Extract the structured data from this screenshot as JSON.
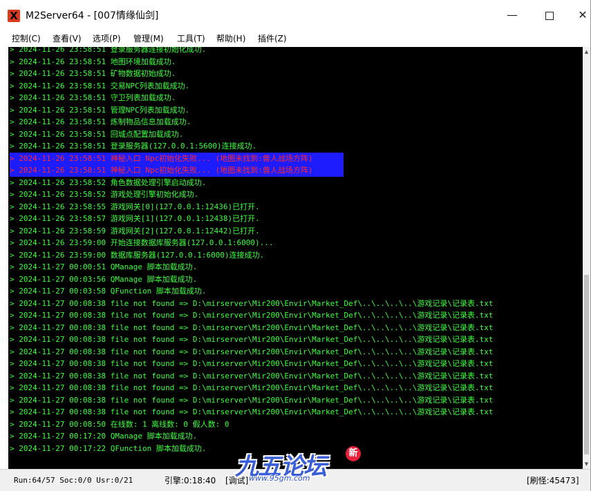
{
  "window": {
    "title": "M2Server64 - [007情缘仙剑]",
    "app_icon": "X",
    "controls": {
      "minimize": "—",
      "close": "✕"
    }
  },
  "menu": [
    "控制(C)",
    "查看(V)",
    "选项(P)",
    "管理(M)",
    "工具(T)",
    "帮助(H)",
    "插件(Z)"
  ],
  "log": [
    {
      "text": "> 2024-11-26 23:58:51 登录服务器连接初始化成功.",
      "level": "info"
    },
    {
      "text": "> 2024-11-26 23:58:51 地图环境加载成功.",
      "level": "info"
    },
    {
      "text": "> 2024-11-26 23:58:51 矿物数据初始成功.",
      "level": "info"
    },
    {
      "text": "> 2024-11-26 23:58:51 交易NPC列表加载成功.",
      "level": "info"
    },
    {
      "text": "> 2024-11-26 23:58:51 守卫列表加载成功.",
      "level": "info"
    },
    {
      "text": "> 2024-11-26 23:58:51 管理NPC列表加载成功.",
      "level": "info"
    },
    {
      "text": "> 2024-11-26 23:58:51 炼制物品信息加载成功.",
      "level": "info"
    },
    {
      "text": "> 2024-11-26 23:58:51 回城点配置加载成功.",
      "level": "info"
    },
    {
      "text": "> 2024-11-26 23:58:51 登录服务器(127.0.0.1:5600)连接成功.",
      "level": "info"
    },
    {
      "text": "> 2024-11-26 23:58:51 神秘入口 Npc初始化失败... (地图未找到:兽人战场方阵)",
      "level": "error"
    },
    {
      "text": "> 2024-11-26 23:58:51 神秘入口 Npc初始化失败... (地图未找到:兽人战场方阵)",
      "level": "error"
    },
    {
      "text": "> 2024-11-26 23:58:52 角色数据处理引擎启动成功.",
      "level": "info"
    },
    {
      "text": "> 2024-11-26 23:58:52 游戏处理引擎初始化成功.",
      "level": "info"
    },
    {
      "text": "> 2024-11-26 23:58:55 游戏网关[0](127.0.0.1:12436)已打开.",
      "level": "info"
    },
    {
      "text": "> 2024-11-26 23:58:57 游戏网关[1](127.0.0.1:12438)已打开.",
      "level": "info"
    },
    {
      "text": "> 2024-11-26 23:58:59 游戏网关[2](127.0.0.1:12442)已打开.",
      "level": "info"
    },
    {
      "text": "> 2024-11-26 23:59:00 开始连接数据库服务器(127.0.0.1:6000)...",
      "level": "info"
    },
    {
      "text": "> 2024-11-26 23:59:00 数据库服务器(127.0.0.1:6000)连接成功.",
      "level": "info"
    },
    {
      "text": "> 2024-11-27 00:00:51 QManage 脚本加载成功.",
      "level": "info"
    },
    {
      "text": "> 2024-11-27 00:03:56 QManage 脚本加载成功.",
      "level": "info"
    },
    {
      "text": "> 2024-11-27 00:03:58 QFunction 脚本加载成功.",
      "level": "info"
    },
    {
      "text": "> 2024-11-27 00:08:38 file not found => D:\\mirserver\\Mir200\\Envir\\Market_Def\\..\\..\\..\\..\\游戏记录\\记录表.txt",
      "level": "info"
    },
    {
      "text": "> 2024-11-27 00:08:38 file not found => D:\\mirserver\\Mir200\\Envir\\Market_Def\\..\\..\\..\\..\\游戏记录\\记录表.txt",
      "level": "info"
    },
    {
      "text": "> 2024-11-27 00:08:38 file not found => D:\\mirserver\\Mir200\\Envir\\Market_Def\\..\\..\\..\\..\\游戏记录\\记录表.txt",
      "level": "info"
    },
    {
      "text": "> 2024-11-27 00:08:38 file not found => D:\\mirserver\\Mir200\\Envir\\Market_Def\\..\\..\\..\\..\\游戏记录\\记录表.txt",
      "level": "info"
    },
    {
      "text": "> 2024-11-27 00:08:38 file not found => D:\\mirserver\\Mir200\\Envir\\Market_Def\\..\\..\\..\\..\\游戏记录\\记录表.txt",
      "level": "info"
    },
    {
      "text": "> 2024-11-27 00:08:38 file not found => D:\\mirserver\\Mir200\\Envir\\Market_Def\\..\\..\\..\\..\\游戏记录\\记录表.txt",
      "level": "info"
    },
    {
      "text": "> 2024-11-27 00:08:38 file not found => D:\\mirserver\\Mir200\\Envir\\Market_Def\\..\\..\\..\\..\\游戏记录\\记录表.txt",
      "level": "info"
    },
    {
      "text": "> 2024-11-27 00:08:38 file not found => D:\\mirserver\\Mir200\\Envir\\Market_Def\\..\\..\\..\\..\\游戏记录\\记录表.txt",
      "level": "info"
    },
    {
      "text": "> 2024-11-27 00:08:38 file not found => D:\\mirserver\\Mir200\\Envir\\Market_Def\\..\\..\\..\\..\\游戏记录\\记录表.txt",
      "level": "info"
    },
    {
      "text": "> 2024-11-27 00:08:38 file not found => D:\\mirserver\\Mir200\\Envir\\Market_Def\\..\\..\\..\\..\\游戏记录\\记录表.txt",
      "level": "info"
    },
    {
      "text": "> 2024-11-27 00:08:50 在线数: 1 离线数: 0 假人数: 0",
      "level": "info"
    },
    {
      "text": "> 2024-11-27 00:17:20 QManage 脚本加载成功.",
      "level": "info"
    },
    {
      "text": "> 2024-11-27 00:17:22 QFunction 脚本加载成功.",
      "level": "info"
    }
  ],
  "status": {
    "run": "Run:64/57 Soc:0/0 Usr:0/21",
    "engine": "引擎:0:18:40",
    "engine_extra": "[调试]",
    "refresh": "[刷怪:45473]"
  },
  "watermark": {
    "logo_text": "九五论坛",
    "badge": "新",
    "url": "www.95gm.com"
  },
  "colors": {
    "log_background": "#000000",
    "log_info": "#3cff3c",
    "log_error": "#ff2a2a",
    "log_error_highlight": "#1c1cff"
  }
}
